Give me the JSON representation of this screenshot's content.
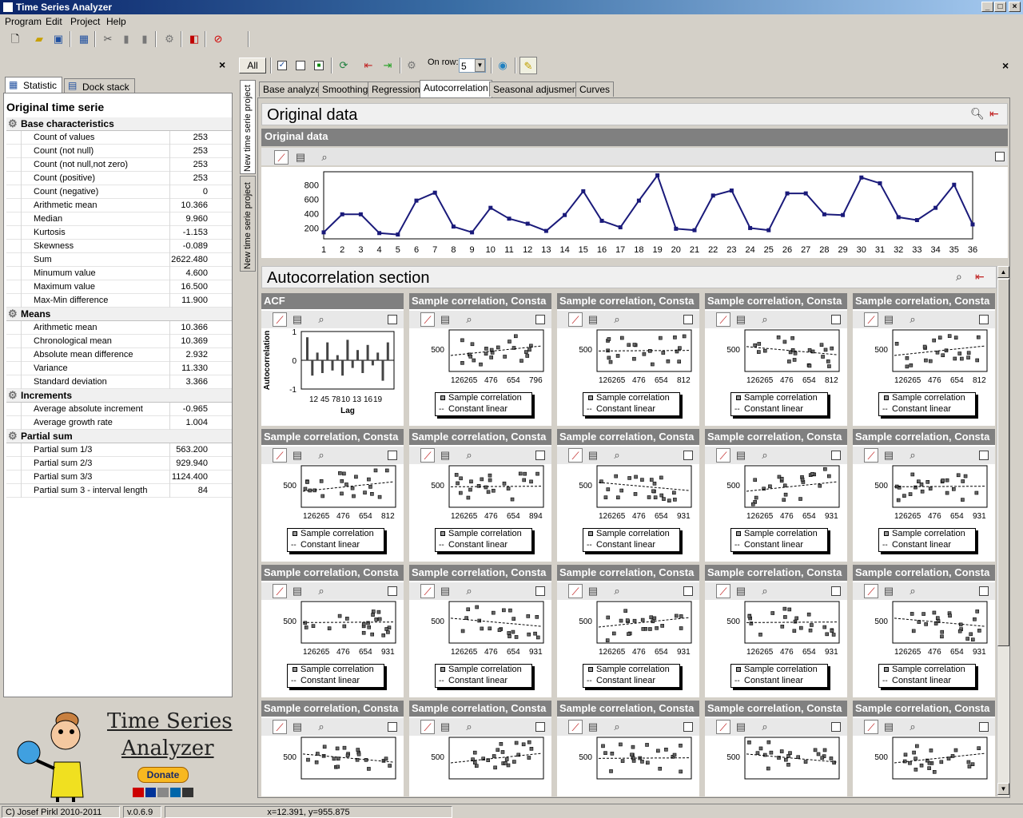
{
  "window": {
    "title": "Time Series Analyzer",
    "btn_min": "_",
    "btn_max": "□",
    "btn_close": "×"
  },
  "menu": [
    "Program",
    "Edit",
    "Project",
    "Help"
  ],
  "toolbar_icons": [
    "new-file-icon",
    "open-folder-icon",
    "save-icon",
    "table-icon",
    "cut-icon",
    "copy-icon",
    "paste-icon",
    "gear-icon",
    "pdf-icon",
    "stop-icon"
  ],
  "right_toolbar": {
    "all_button": "All",
    "on_row_label": "On row:",
    "on_row_value": "5",
    "close": "×"
  },
  "left_panel": {
    "close": "×",
    "tabs": [
      "Statistic",
      "Dock stack"
    ],
    "title": "Original time serie",
    "groups": [
      {
        "name": "Base characteristics",
        "rows": [
          [
            "Count of values",
            "253"
          ],
          [
            "Count (not null)",
            "253"
          ],
          [
            "Count (not null,not zero)",
            "253"
          ],
          [
            "Count (positive)",
            "253"
          ],
          [
            "Count (negative)",
            "0"
          ],
          [
            "Arithmetic mean",
            "10.366"
          ],
          [
            "Median",
            "9.960"
          ],
          [
            "Kurtosis",
            "-1.153"
          ],
          [
            "Skewness",
            "-0.089"
          ],
          [
            "Sum",
            "2622.480"
          ],
          [
            "Minumum value",
            "4.600"
          ],
          [
            "Maximum value",
            "16.500"
          ],
          [
            "Max-Min difference",
            "11.900"
          ]
        ]
      },
      {
        "name": "Means",
        "rows": [
          [
            "Arithmetic mean",
            "10.366"
          ],
          [
            "Chronological mean",
            "10.369"
          ],
          [
            "Absolute mean difference",
            "2.932"
          ],
          [
            "Variance",
            "11.330"
          ],
          [
            "Standard deviation",
            "3.366"
          ]
        ]
      },
      {
        "name": "Increments",
        "rows": [
          [
            "Average absolute increment",
            "-0.965"
          ],
          [
            "Average growth rate",
            "1.004"
          ]
        ]
      },
      {
        "name": "Partial sum",
        "rows": [
          [
            "Partial sum 1/3",
            "563.200"
          ],
          [
            "Partial sum 2/3",
            "929.940"
          ],
          [
            "Partial sum 3/3",
            "1124.400"
          ],
          [
            "Partial sum 3 - interval length",
            "84"
          ]
        ]
      }
    ]
  },
  "logo": {
    "line1": "Time Series",
    "line2": "Analyzer",
    "donate": "Donate"
  },
  "status": {
    "copyright": "C) Josef Pirkl 2010-2011",
    "version": "v.0.6.9",
    "coords": "x=12.391, y=955.875"
  },
  "vertical_tabs": [
    "New time serie project",
    "New time serie project"
  ],
  "tabs": [
    "Base analyze",
    "Smoothing",
    "Regression",
    "Autocorrelation",
    "Seasonal adjusment",
    "Curves"
  ],
  "active_tab": 3,
  "original": {
    "section_title": "Original data",
    "bar_title": "Original data"
  },
  "autocorr": {
    "section_title": "Autocorrelation section",
    "acf_title": "ACF",
    "acf_ylabel": "Autocorrelation",
    "acf_xlabel": "Lag",
    "acf_yticks": [
      "1",
      "0",
      "-1"
    ],
    "acf_xticks": [
      "12",
      "45",
      "78",
      "10",
      "13",
      "16",
      "19"
    ],
    "cell_title": "Sample correlation, Consta",
    "legend1": "Sample correlation",
    "legend2": "Constant linear",
    "ytick": "500",
    "row_xticks": [
      [
        [
          "126265",
          "476",
          "654",
          "796"
        ],
        [
          "126265",
          "476",
          "654",
          "812"
        ],
        [
          "126265",
          "476",
          "654",
          "812"
        ],
        [
          "126265",
          "476",
          "654",
          "812"
        ]
      ],
      [
        [
          "126265",
          "476",
          "654",
          "812"
        ],
        [
          "126265",
          "476",
          "654",
          "894"
        ],
        [
          "126265",
          "476",
          "654",
          "931"
        ],
        [
          "126265",
          "476",
          "654",
          "931"
        ],
        [
          "126265",
          "476",
          "654",
          "931"
        ]
      ],
      [
        [
          "126265",
          "476",
          "654",
          "931"
        ],
        [
          "126265",
          "476",
          "654",
          "931"
        ],
        [
          "126265",
          "476",
          "654",
          "931"
        ],
        [
          "126265",
          "476",
          "654",
          "931"
        ],
        [
          "126265",
          "476",
          "654",
          "931"
        ]
      ]
    ]
  },
  "chart_data": {
    "type": "line",
    "x": [
      1,
      2,
      3,
      4,
      5,
      6,
      7,
      8,
      9,
      10,
      11,
      12,
      13,
      14,
      15,
      16,
      17,
      18,
      19,
      20,
      21,
      22,
      23,
      24,
      25,
      26,
      27,
      28,
      29,
      30,
      31,
      32,
      33,
      34,
      35,
      36
    ],
    "values": [
      140,
      390,
      390,
      130,
      110,
      580,
      690,
      220,
      140,
      480,
      330,
      260,
      160,
      380,
      710,
      300,
      210,
      580,
      930,
      190,
      170,
      650,
      720,
      200,
      170,
      680,
      680,
      390,
      380,
      900,
      820,
      350,
      310,
      480,
      800,
      250
    ],
    "yticks": [
      200,
      400,
      600,
      800
    ],
    "ylim": [
      50,
      980
    ],
    "xlim": [
      1,
      36
    ]
  }
}
